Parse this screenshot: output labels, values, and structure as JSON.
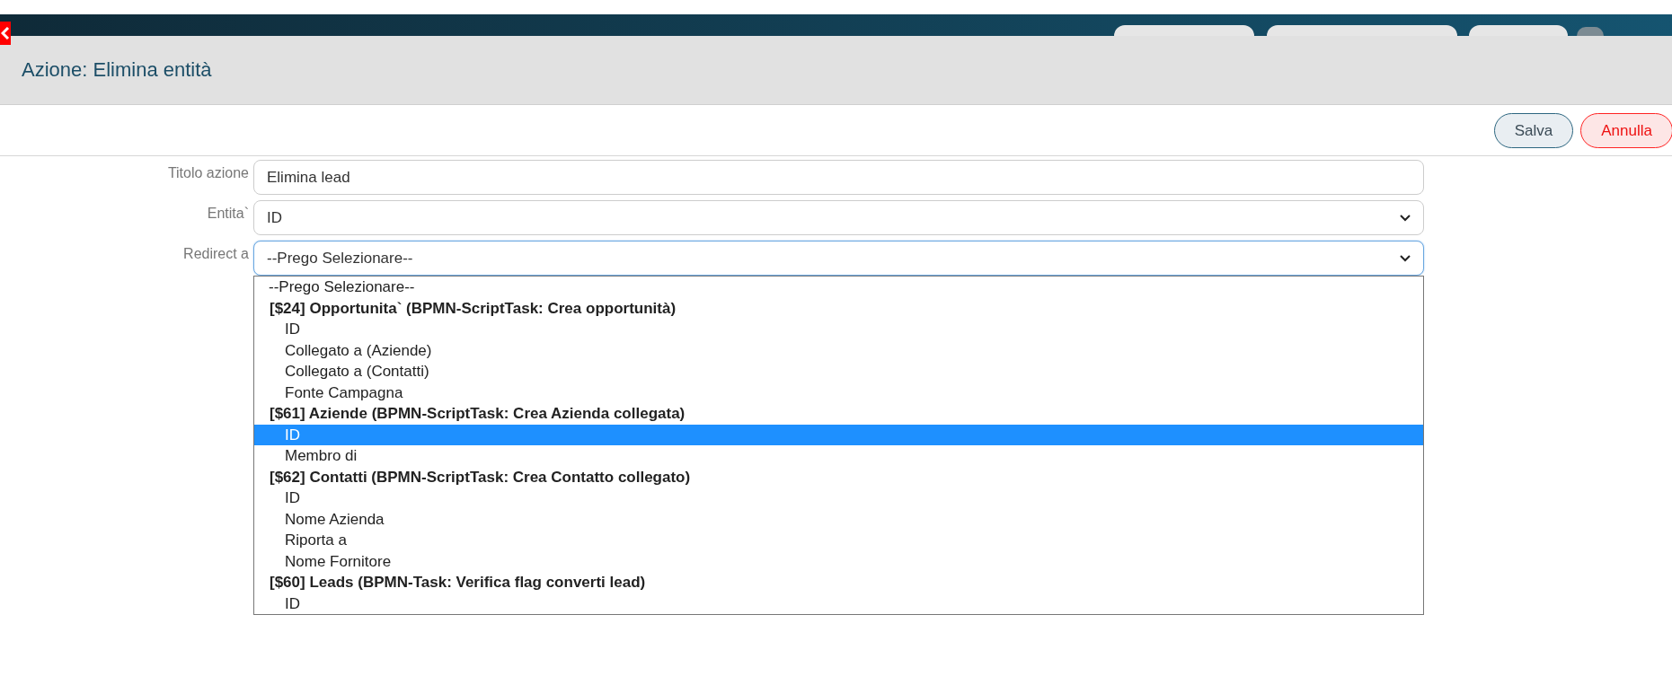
{
  "header": {
    "title": "Azione: Elimina entità"
  },
  "buttons": [
    {
      "label": "Salva",
      "kind": "primary"
    },
    {
      "label": "Annulla",
      "kind": "cancel"
    }
  ],
  "fields": [
    {
      "label": "Titolo azione",
      "kind": "text",
      "value": "Elimina lead",
      "focused": false
    },
    {
      "label": "Entita`",
      "kind": "select",
      "value": "ID",
      "focused": false
    },
    {
      "label": "Redirect a",
      "kind": "select",
      "value": "--Prego Selezionare--",
      "focused": true
    }
  ],
  "dropdown": {
    "placeholder_option": {
      "label": "--Prego Selezionare--",
      "selected": false
    },
    "groups": [
      {
        "label": "[$24] Opportunita` (BPMN-ScriptTask: Crea opportunità)",
        "children": [
          {
            "label": "ID",
            "selected": false
          },
          {
            "label": "Collegato a (Aziende)",
            "selected": false
          },
          {
            "label": "Collegato a (Contatti)",
            "selected": false
          },
          {
            "label": "Fonte Campagna",
            "selected": false
          }
        ]
      },
      {
        "label": "[$61] Aziende (BPMN-ScriptTask: Crea Azienda collegata)",
        "children": [
          {
            "label": "ID",
            "selected": true
          },
          {
            "label": "Membro di",
            "selected": false
          }
        ]
      },
      {
        "label": "[$62] Contatti (BPMN-ScriptTask: Crea Contatto collegato)",
        "children": [
          {
            "label": "ID",
            "selected": false
          },
          {
            "label": "Nome Azienda",
            "selected": false
          },
          {
            "label": "Riporta a",
            "selected": false
          },
          {
            "label": "Nome Fornitore",
            "selected": false
          }
        ]
      },
      {
        "label": "[$60] Leads (BPMN-Task: Verifica flag converti lead)",
        "children": [
          {
            "label": "ID",
            "selected": false
          }
        ]
      }
    ]
  }
}
